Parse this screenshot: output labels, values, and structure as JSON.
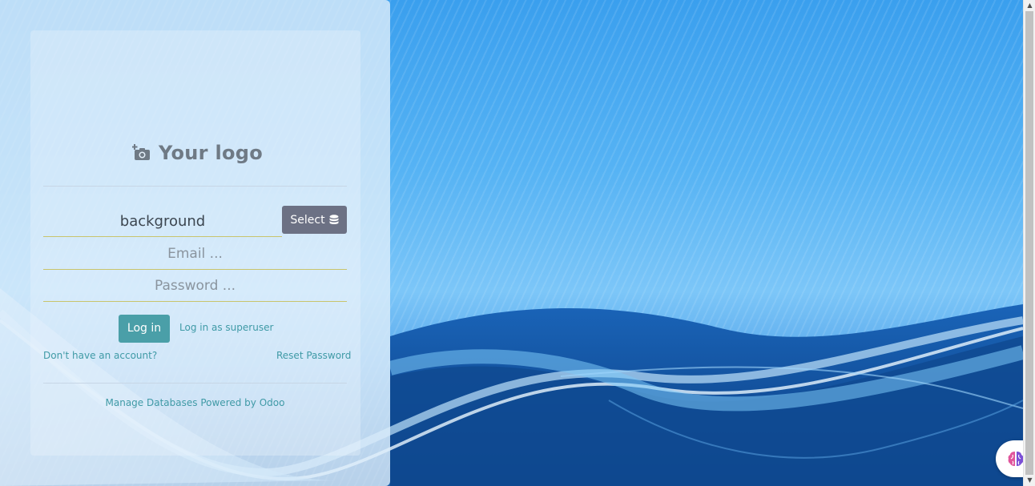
{
  "logo": {
    "text": "Your logo",
    "icon": "camera-plus-icon"
  },
  "database": {
    "value": "background",
    "select_label": "Select",
    "select_icon": "database-icon"
  },
  "login_form": {
    "email_placeholder": "Email ...",
    "password_placeholder": "Password ..."
  },
  "buttons": {
    "login": "Log in",
    "login_superuser": "Log in as superuser"
  },
  "links": {
    "signup": "Don't have an account?",
    "reset_password": "Reset Password"
  },
  "footer": {
    "manage_databases": "Manage Databases",
    "powered_by": "Powered by Odoo"
  },
  "colors": {
    "primary": "#4a9fa8",
    "select_button": "#6c7184",
    "link": "#3f9aa6",
    "field_underline": "#c9c46c"
  },
  "assistant": {
    "icon": "brain-icon"
  }
}
